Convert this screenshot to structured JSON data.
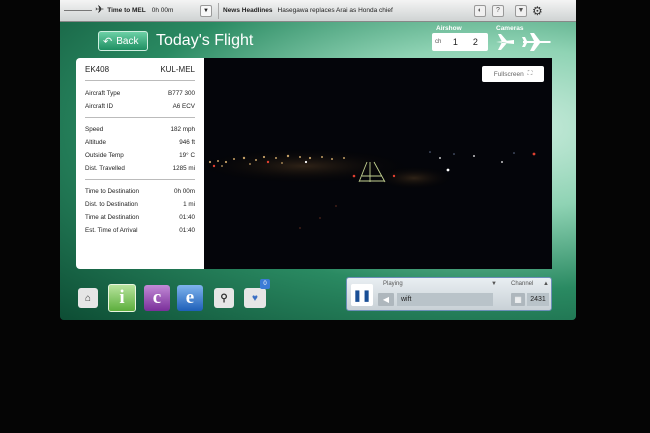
{
  "topbar": {
    "route_label": "Time to MEL",
    "route_time": "0h 00m",
    "news_label": "News Headlines",
    "news_text": "Hasegawa replaces Arai as Honda chief",
    "help_label": "?"
  },
  "header": {
    "back_label": "Back",
    "title": "Today's Flight"
  },
  "airshow": {
    "label": "Airshow",
    "ch_label": "ch",
    "channel_1": "1",
    "channel_2": "2"
  },
  "cameras": {
    "label": "Cameras"
  },
  "flight": {
    "number": "EK408",
    "route": "KUL-MEL",
    "aircraft": [
      {
        "label": "Aircraft Type",
        "value": "B777 300"
      },
      {
        "label": "Aircraft ID",
        "value": "A6 ECV"
      }
    ],
    "stats": [
      {
        "label": "Speed",
        "value": "182 mph"
      },
      {
        "label": "Altitude",
        "value": "946 ft"
      },
      {
        "label": "Outside Temp",
        "value": "19° C"
      },
      {
        "label": "Dist. Travelled",
        "value": "1285 mi"
      }
    ],
    "destination": [
      {
        "label": "Time to Destination",
        "value": "0h 00m"
      },
      {
        "label": "Dist. to Destination",
        "value": "1 mi"
      },
      {
        "label": "Time at Destination",
        "value": "01:40"
      },
      {
        "label": "Est. Time of Arrival",
        "value": "01:40"
      }
    ]
  },
  "video": {
    "fullscreen_label": "Fullscreen"
  },
  "nav": {
    "i_label": "i",
    "c_label": "c",
    "e_label": "e",
    "favorites_count": "0"
  },
  "player": {
    "status_label": "Playing",
    "track": "wift",
    "channel_label": "Channel",
    "channel_number": "2431"
  },
  "colors": {
    "accent_green": "#1f8f62",
    "player_blue": "#1a4f96",
    "c_purple": "#7a2f9a",
    "e_blue": "#1e5fb8"
  }
}
